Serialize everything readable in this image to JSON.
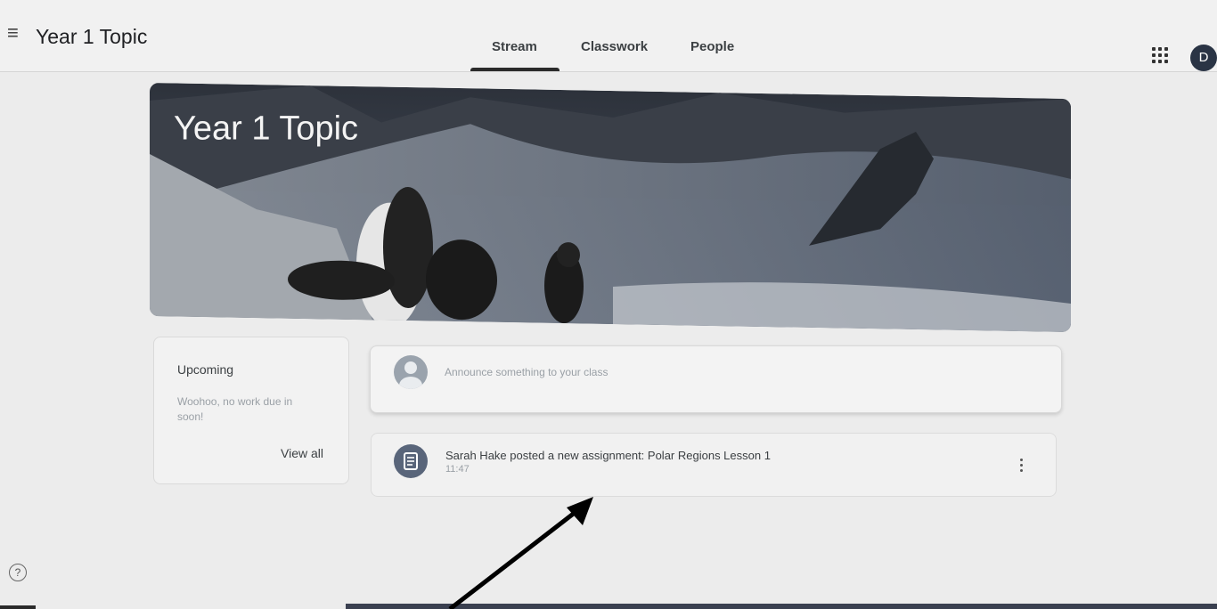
{
  "header": {
    "menu_icon": "hamburger-menu-icon",
    "class_title": "Year 1 Topic",
    "tabs": [
      {
        "label": "Stream",
        "active": true
      },
      {
        "label": "Classwork",
        "active": false
      },
      {
        "label": "People",
        "active": false
      }
    ],
    "apps_icon": "apps-grid-icon",
    "avatar_initial": "D"
  },
  "banner": {
    "title": "Year 1 Topic",
    "theme_image": "penguins-snowy-mountains"
  },
  "upcoming": {
    "title": "Upcoming",
    "message": "Woohoo, no work due in soon!",
    "view_all": "View all"
  },
  "announce": {
    "placeholder": "Announce something to your class"
  },
  "stream": {
    "posts": [
      {
        "text": "Sarah Hake posted a new assignment: Polar Regions Lesson 1",
        "time": "11:47",
        "icon": "assignment-icon"
      }
    ]
  },
  "colors": {
    "avatar_bg": "#2a3445",
    "post_icon_bg": "#59657a",
    "active_tab_underline": "#2b2b2b"
  },
  "overlay": {
    "annotation": "black-arrow-pointing-to-assignment"
  }
}
